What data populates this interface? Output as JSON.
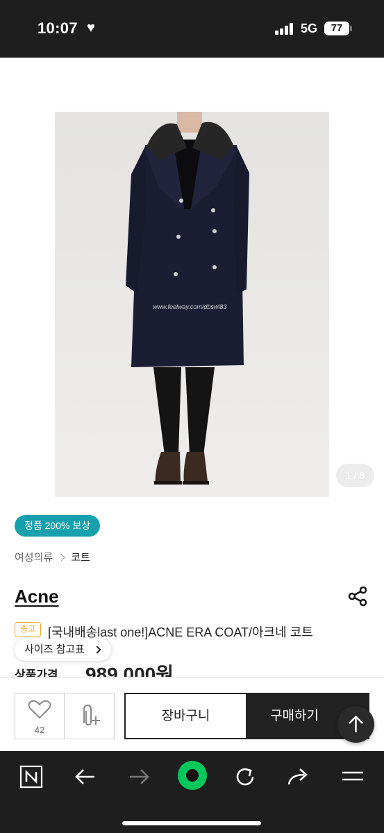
{
  "status_bar": {
    "time": "10:07",
    "network": "5G",
    "battery": "77"
  },
  "gallery": {
    "watermark": "www.feelway.com/dbswl83",
    "counter": "1 / 8"
  },
  "product": {
    "auth_badge": "정품 200% 보상",
    "breadcrumb": [
      "여성의류",
      "코트"
    ],
    "brand": "Acne",
    "condition_badge": "중고",
    "title": "[국내배송last one!]ACNE ERA COAT/아크네 코트",
    "size_guide_label": "사이즈 참고표",
    "price_label": "상품가격",
    "price": "989,000원"
  },
  "actions": {
    "like_count": "42",
    "cart_label": "장바구니",
    "buy_label": "구매하기"
  },
  "browser_toolbar": {
    "icons": [
      "naver-n-icon",
      "back-arrow-icon",
      "forward-arrow-icon",
      "green-dot-icon",
      "refresh-icon",
      "share-arrow-icon",
      "menu-icon"
    ]
  },
  "colors": {
    "status_bar_bg": "#1e1e1e",
    "auth_badge": "#16a0ae",
    "condition_badge": "#f0a72a",
    "buy_button": "#222222",
    "naver_green": "#03c75a"
  }
}
